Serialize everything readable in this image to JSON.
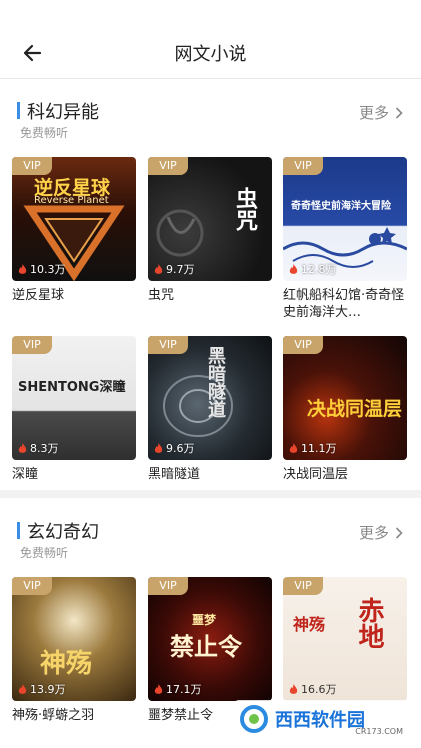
{
  "header": {
    "title": "网文小说"
  },
  "sections": [
    {
      "title": "科幻异能",
      "subtitle": "免费畅听",
      "more": "更多",
      "books": [
        {
          "name": "逆反星球",
          "plays": "10.3万",
          "vip": "VIP",
          "cover_text": "逆反星球",
          "cover_sub": "Reverse Planet"
        },
        {
          "name": "虫咒",
          "plays": "9.7万",
          "vip": "VIP",
          "cover_text": "虫咒",
          "cover_sub": ""
        },
        {
          "name": "红帆船科幻馆·奇奇怪史前海洋大…",
          "plays": "12.8万",
          "vip": "VIP",
          "cover_text": "奇奇怪史前海洋大冒险",
          "cover_sub": ""
        },
        {
          "name": "深瞳",
          "plays": "8.3万",
          "vip": "VIP",
          "cover_text": "SHENTONG深瞳",
          "cover_sub": ""
        },
        {
          "name": "黑暗隧道",
          "plays": "9.6万",
          "vip": "VIP",
          "cover_text": "黑暗隧道",
          "cover_sub": ""
        },
        {
          "name": "决战同温层",
          "plays": "11.1万",
          "vip": "VIP",
          "cover_text": "决战同温层",
          "cover_sub": ""
        }
      ]
    },
    {
      "title": "玄幻奇幻",
      "subtitle": "免费畅听",
      "more": "更多",
      "books": [
        {
          "name": "神殇·蜉蝣之羽",
          "plays": "13.9万",
          "vip": "VIP",
          "cover_text": "神殇",
          "cover_sub": ""
        },
        {
          "name": "噩梦禁止令",
          "plays": "17.1万",
          "vip": "VIP",
          "cover_text": "禁止令",
          "cover_sub": "噩梦"
        },
        {
          "name": "",
          "plays": "16.6万",
          "vip": "VIP",
          "cover_text": "赤地",
          "cover_sub": "神殇"
        }
      ]
    }
  ],
  "watermark": {
    "text": "西西软件园",
    "sub": "CR173.COM"
  },
  "colors": {
    "accent": "#3a8ee6",
    "vip": "#c9a46a",
    "fire": "#e8452c"
  }
}
